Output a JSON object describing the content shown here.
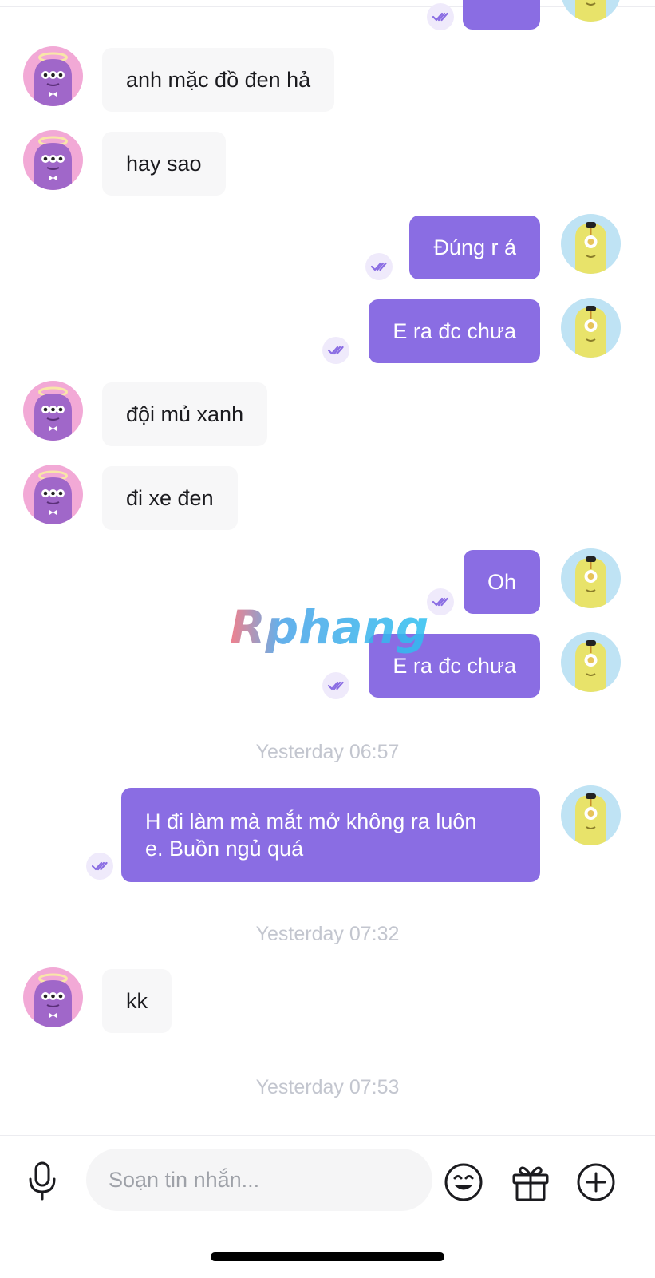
{
  "conversation": {
    "messages": [
      {
        "sender": "other",
        "text": "anh mặc đồ đen hả"
      },
      {
        "sender": "other",
        "text": "hay sao"
      },
      {
        "sender": "me",
        "text": "Đúng r á"
      },
      {
        "sender": "me",
        "text": "E ra đc chưa"
      },
      {
        "sender": "other",
        "text": "đội mủ xanh"
      },
      {
        "sender": "other",
        "text": "đi xe đen"
      },
      {
        "sender": "me",
        "text": "Oh"
      },
      {
        "sender": "me",
        "text": "E ra đc chưa"
      },
      {
        "sender": "me",
        "text": "H đi làm mà mắt mở không ra luôn\ne. Buồn ngủ quá"
      },
      {
        "sender": "other",
        "text": "kk"
      }
    ],
    "timestamps": [
      "Yesterday 06:57",
      "Yesterday 07:32",
      "Yesterday 07:53"
    ]
  },
  "watermark": {
    "text": "Rphang"
  },
  "composer": {
    "placeholder": "Soạn tin nhắn...",
    "icons": [
      "microphone-icon",
      "emoji-icon",
      "gift-icon",
      "add-icon"
    ]
  },
  "colors": {
    "outgoing_bubble": "#8a6de3",
    "incoming_bubble": "#f7f7f8",
    "read_receipt": "#8a6de3",
    "timestamp_text": "#c3c6cf"
  }
}
